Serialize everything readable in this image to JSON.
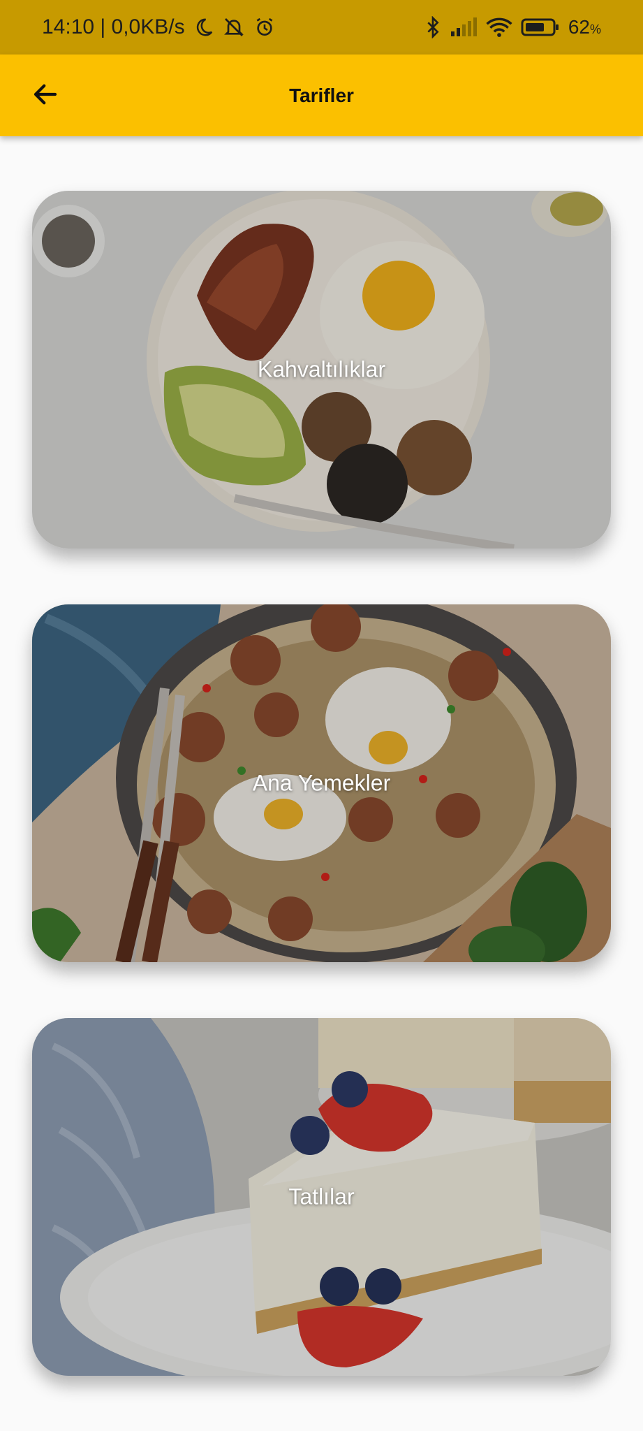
{
  "status_bar": {
    "time_and_speed": "14:10 | 0,0KB/s",
    "battery_level": "62",
    "battery_unit": "%"
  },
  "app_bar": {
    "title": "Tarifler"
  },
  "categories": [
    {
      "label": "Kahvaltılıklar"
    },
    {
      "label": "Ana Yemekler"
    },
    {
      "label": "Tatlılar"
    }
  ]
}
